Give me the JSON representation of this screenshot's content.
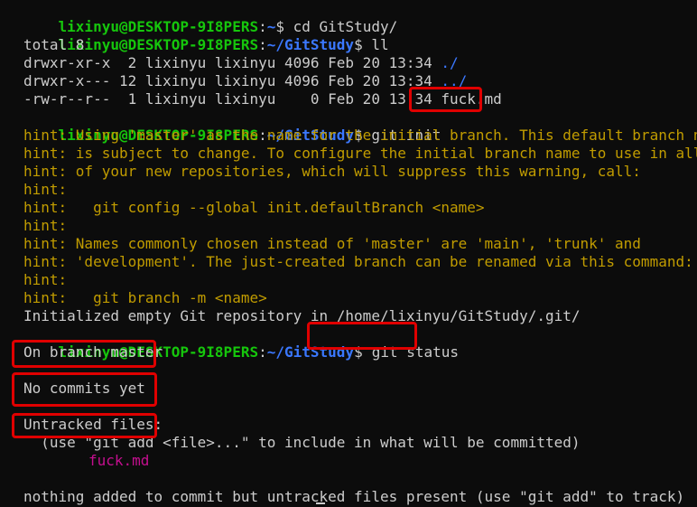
{
  "prompt": {
    "user_host": "lixinyu@DESKTOP-9I8PERS",
    "colon": ":",
    "home_path": "~",
    "repo_path": "~/GitStudy",
    "symbol": "$"
  },
  "commands": {
    "cd": " cd GitStudy/",
    "ll": " ll",
    "git_init": " git init",
    "git_status": "git status"
  },
  "ll_output": {
    "total": "total 8",
    "row1_meta": "drwxr-xr-x  2 lixinyu lixinyu 4096 Feb 20 13:34 ",
    "row1_name": "./",
    "row2_meta": "drwxr-x--- 12 lixinyu lixinyu 4096 Feb 20 13:34 ",
    "row2_name": "../",
    "row3_meta": "-rw-r--r--  1 lixinyu lixinyu    0 Feb 20 13:34 ",
    "row3_name": "fuck.md"
  },
  "hints": [
    "hint: Using 'master' as the name for the initial branch. This default branch name",
    "hint: is subject to change. To configure the initial branch name to use in all",
    "hint: of your new repositories, which will suppress this warning, call:",
    "hint:",
    "hint:   git config --global init.defaultBranch <name>",
    "hint:",
    "hint: Names commonly chosen instead of 'master' are 'main', 'trunk' and",
    "hint: 'development'. The just-created branch can be renamed via this command:",
    "hint:",
    "hint:   git branch -m <name>"
  ],
  "init_result": "Initialized empty Git repository in /home/lixinyu/GitStudy/.git/",
  "status": {
    "branch": "On branch master",
    "no_commits": "No commits yet",
    "untracked_header": "Untracked files:",
    "use_hint": "  (use \"git add <file>...\" to include in what will be committed)",
    "untracked_file": "fuck.md",
    "footer": "nothing added to commit but untracked files present (use \"git add\" to track)"
  },
  "colors": {
    "background": "#0c0c0c",
    "text": "#cccccc",
    "prompt_user": "#16c60c",
    "prompt_path": "#3b78ff",
    "hint": "#c19c00",
    "untracked": "#c50f8f",
    "highlight_box": "#e00000"
  }
}
